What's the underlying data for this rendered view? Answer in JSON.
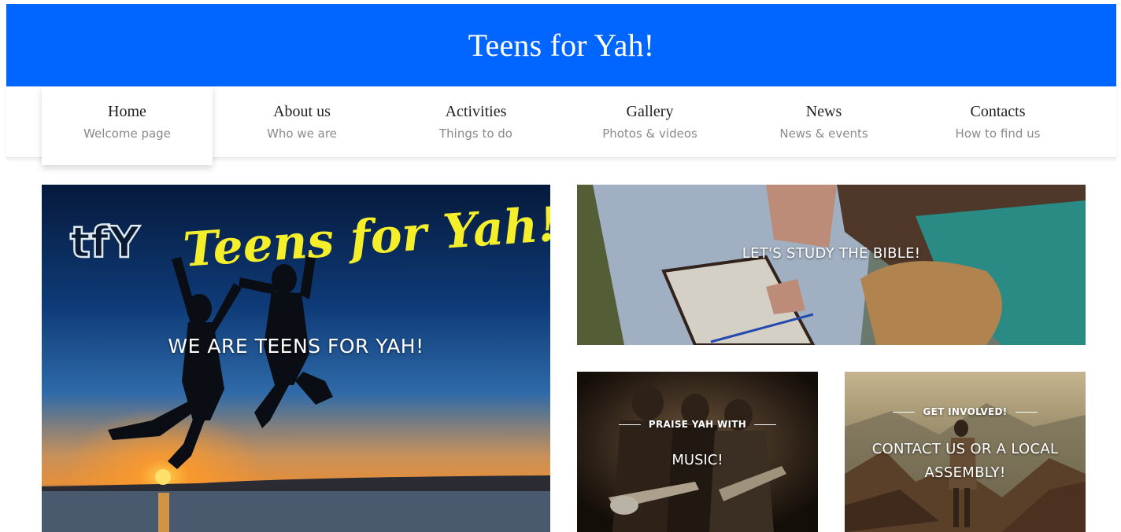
{
  "site": {
    "title": "Teens for Yah!"
  },
  "nav": {
    "items": [
      {
        "label": "Home",
        "sub": "Welcome page"
      },
      {
        "label": "About us",
        "sub": "Who we are"
      },
      {
        "label": "Activities",
        "sub": "Things to do"
      },
      {
        "label": "Gallery",
        "sub": "Photos & videos"
      },
      {
        "label": "News",
        "sub": "News & events"
      },
      {
        "label": "Contacts",
        "sub": "How to find us"
      }
    ],
    "active": "Home"
  },
  "tiles": {
    "main": {
      "logo_mark": "tfY",
      "logo_text": "Teens for Yah!",
      "caption": "WE ARE TEENS FOR YAH!"
    },
    "bible": {
      "caption": "LET'S STUDY THE BIBLE!"
    },
    "music": {
      "pre": "PRAISE YAH WITH",
      "caption": "MUSIC!"
    },
    "contact": {
      "pre": "GET INVOLVED!",
      "caption_line1": "CONTACT US OR A LOCAL",
      "caption_line2": "ASSEMBLY!"
    }
  },
  "colors": {
    "header_bg": "#0066ff",
    "logo_yellow": "#f5ee2a"
  }
}
